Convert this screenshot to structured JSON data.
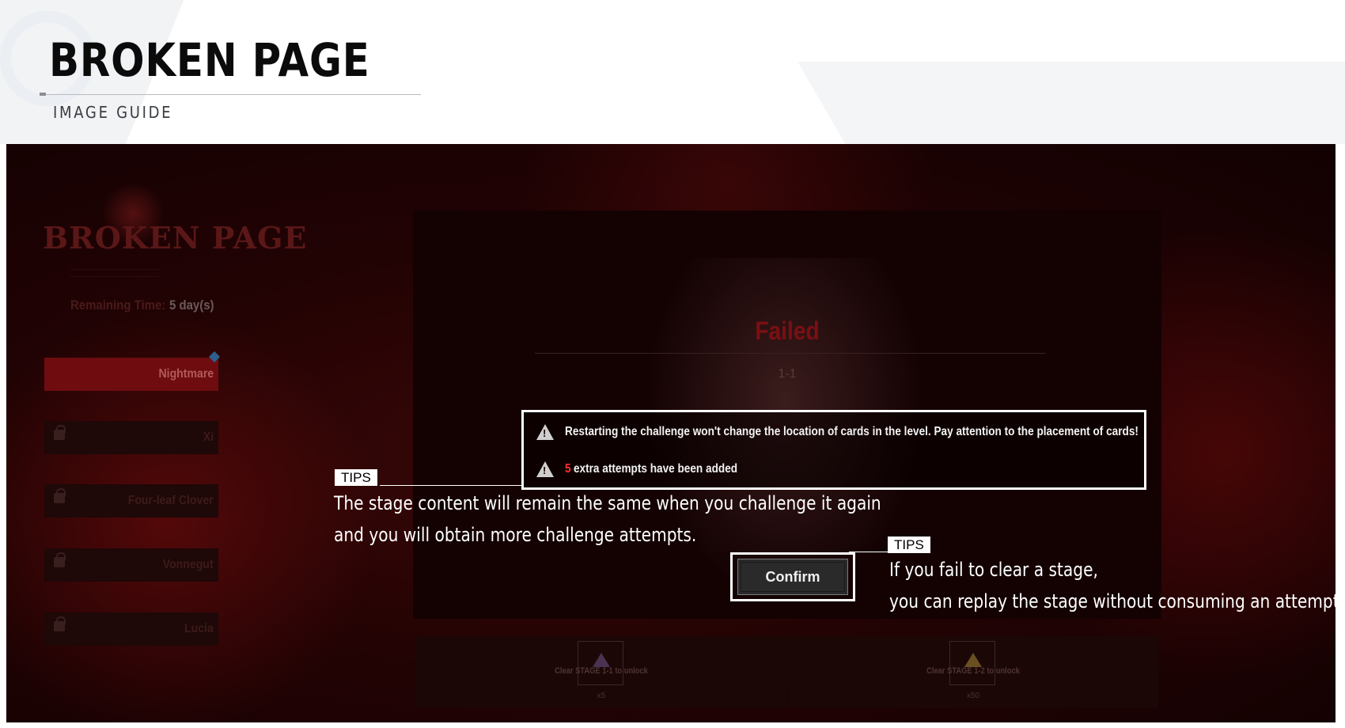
{
  "header": {
    "title": "BROKEN PAGE",
    "subtitle": "IMAGE GUIDE"
  },
  "game": {
    "event_logo": "BROKEN PAGE",
    "remaining_time_label": "Remaining Time:",
    "remaining_time_value": "5 day(s)",
    "difficulties": [
      {
        "label": "Nightmare",
        "locked": false,
        "selected": true
      },
      {
        "label": "Xi",
        "locked": true
      },
      {
        "label": "Four-leaf Clover",
        "locked": true
      },
      {
        "label": "Vonnegut",
        "locked": true
      },
      {
        "label": "Lucia",
        "locked": true
      }
    ],
    "result_text": "Failed",
    "stage_code": "1-1",
    "warnings": {
      "line1": "Restarting the challenge won't change the location of cards in the level. Pay attention to the placement of cards!",
      "line2_number": "5",
      "line2_text": "extra attempts have been added"
    },
    "confirm_label": "Confirm",
    "rewards": [
      {
        "unlock_text": "Clear STAGE 1-1 to unlock",
        "quantity": "x5"
      },
      {
        "unlock_text": "Clear STAGE 1-2 to unlock",
        "quantity": "x50"
      }
    ]
  },
  "tips": {
    "tag_label": "TIPS",
    "tip1_line1": "The stage content will remain the same when you challenge it again",
    "tip1_line2": "and you will obtain more challenge attempts.",
    "tip2_line1": "If you fail to clear a stage,",
    "tip2_line2": "you can replay the stage without consuming an attempt."
  },
  "colors": {
    "accent_red": "#ff3030",
    "highlight_border": "#ffffff",
    "background_dark_red": "#230304"
  }
}
